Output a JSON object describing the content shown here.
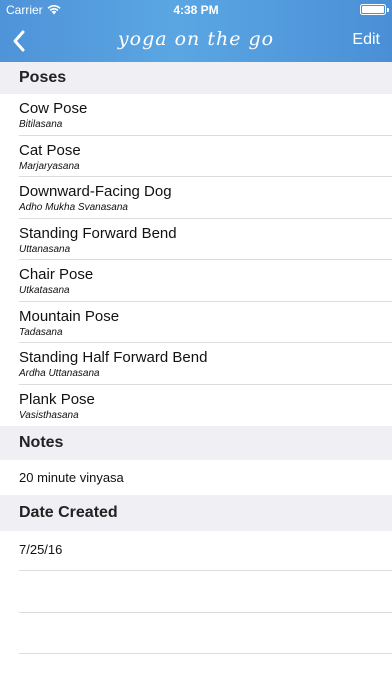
{
  "status_bar": {
    "carrier": "Carrier",
    "time": "4:38 PM"
  },
  "nav": {
    "title": "yoga on the go",
    "edit_label": "Edit"
  },
  "poses_header": "Poses",
  "poses": [
    {
      "name": "Cow Pose",
      "sanskrit": "Bitilasana"
    },
    {
      "name": "Cat Pose",
      "sanskrit": "Marjaryasana"
    },
    {
      "name": "Downward-Facing Dog",
      "sanskrit": "Adho Mukha Svanasana"
    },
    {
      "name": "Standing Forward Bend",
      "sanskrit": "Uttanasana"
    },
    {
      "name": "Chair Pose",
      "sanskrit": "Utkatasana"
    },
    {
      "name": "Mountain Pose",
      "sanskrit": "Tadasana"
    },
    {
      "name": "Standing Half Forward Bend",
      "sanskrit": "Ardha Uttanasana"
    },
    {
      "name": "Plank Pose",
      "sanskrit": "Vasisthasana"
    }
  ],
  "notes_header": "Notes",
  "notes_value": "20 minute vinyasa",
  "date_header": "Date Created",
  "date_value": "7/25/16"
}
